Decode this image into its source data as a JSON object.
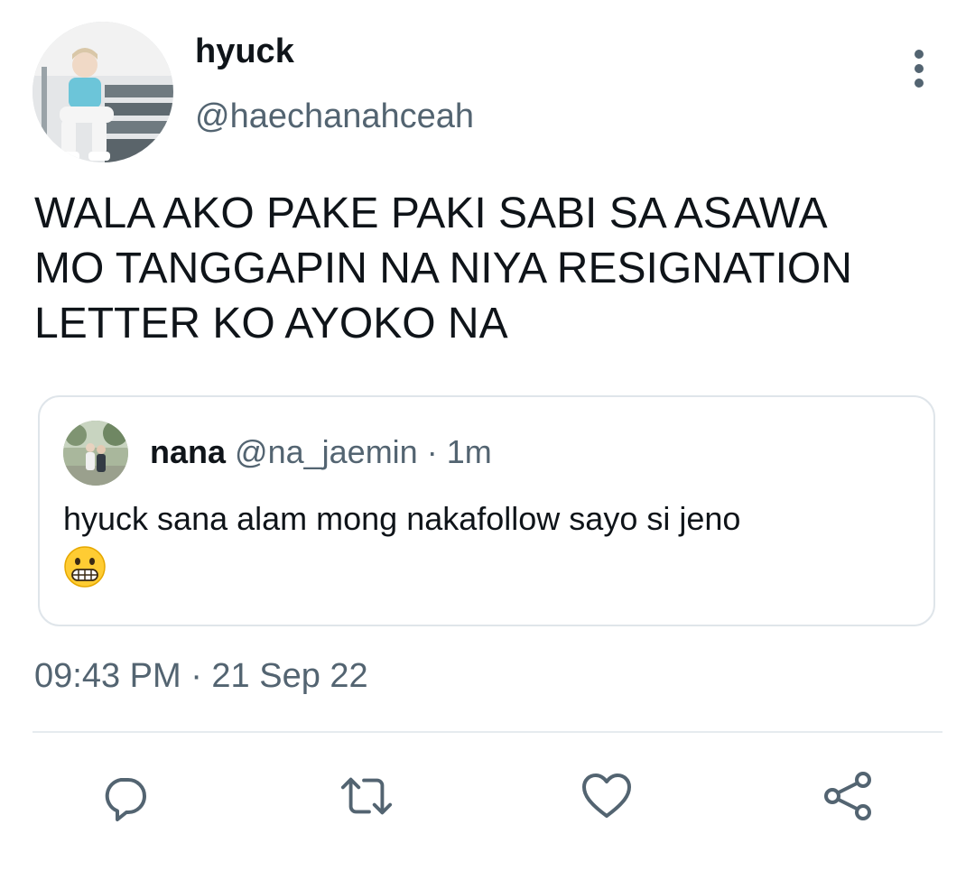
{
  "author": {
    "display_name": "hyuck",
    "handle": "@haechanahceah",
    "avatar_icon": "profile-photo-avatar"
  },
  "tweet": {
    "text": "WALA AKO PAKE PAKI SABI SA ASAWA\nMO TANGGAPIN NA NIYA RESIGNATION\nLETTER KO AYOKO NA",
    "timestamp": "09:43 PM · 21 Sep 22"
  },
  "quoted_tweet": {
    "display_name": "nana",
    "handle": "@na_jaemin",
    "separator": "·",
    "time": "1m",
    "text": "hyuck sana alam mong nakafollow sayo si jeno",
    "emoji": "grimacing-face-emoji"
  },
  "actions": {
    "reply_icon": "reply-icon",
    "retweet_icon": "retweet-icon",
    "like_icon": "heart-icon",
    "share_icon": "share-icon",
    "more_icon": "more-vertical-icon"
  },
  "colors": {
    "text_primary": "#0f1419",
    "text_secondary": "#536471",
    "border": "#dfe5ea"
  }
}
